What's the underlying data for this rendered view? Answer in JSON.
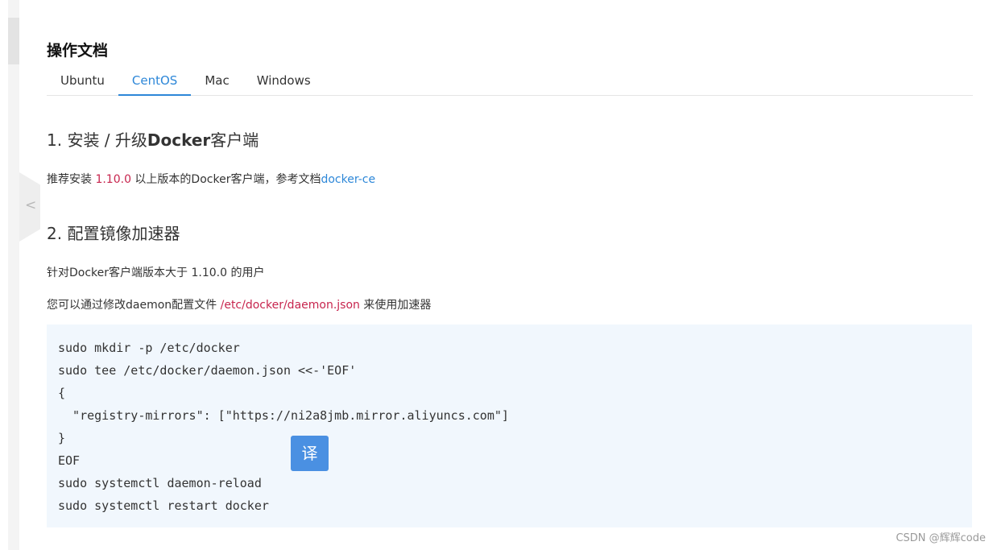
{
  "doc": {
    "title": "操作文档",
    "tabs": [
      {
        "label": "Ubuntu"
      },
      {
        "label": "CentOS",
        "active": true
      },
      {
        "label": "Mac"
      },
      {
        "label": "Windows"
      }
    ],
    "section1": {
      "num": "1.",
      "pre": "安装 / 升级",
      "bold": "Docker",
      "post": "客户端",
      "para_a": "推荐安装 ",
      "para_version": "1.10.0",
      "para_b": " 以上版本的Docker客户端，参考文档",
      "para_link": "docker-ce"
    },
    "section2": {
      "heading": "2. 配置镜像加速器",
      "para1": "针对Docker客户端版本大于 1.10.0 的用户",
      "para2_a": "您可以通过修改daemon配置文件 ",
      "para2_path": "/etc/docker/daemon.json",
      "para2_b": " 来使用加速器"
    },
    "code": [
      "sudo mkdir -p /etc/docker",
      "sudo tee /etc/docker/daemon.json <<-'EOF'",
      "{",
      "  \"registry-mirrors\": [\"https://ni2a8jmb.mirror.aliyuncs.com\"]",
      "}",
      "EOF",
      "sudo systemctl daemon-reload",
      "sudo systemctl restart docker"
    ]
  },
  "translate_button": "译",
  "collapse_icon": "chevron-left-icon",
  "collapse_glyph": "<",
  "watermark": "CSDN @辉辉code",
  "colors": {
    "accent": "#2d87d8",
    "highlight": "#c7254e",
    "code_bg": "#f1f7fd",
    "translate_bg": "#4a90e2"
  }
}
